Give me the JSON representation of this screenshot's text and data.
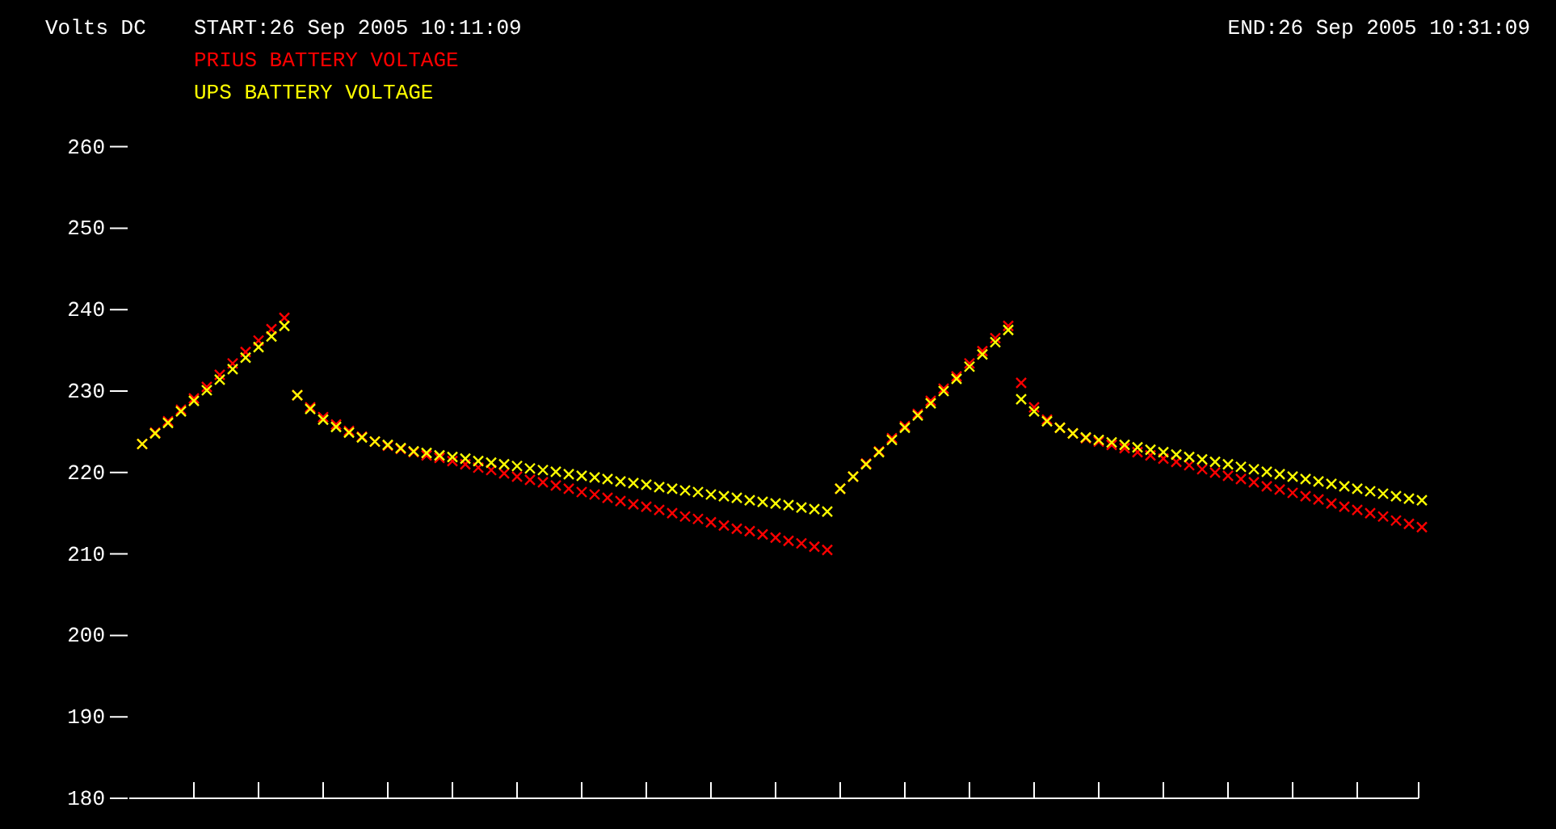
{
  "header": {
    "y_axis_label": "Volts DC",
    "start": "START:26 Sep 2005 10:11:09",
    "end": "END:26 Sep 2005 10:31:09"
  },
  "legend": [
    {
      "label": "PRIUS BATTERY VOLTAGE",
      "color": "#ff0000"
    },
    {
      "label": "UPS BATTERY VOLTAGE",
      "color": "#ffff00"
    }
  ],
  "y_tick_labels": [
    "260",
    "250",
    "240",
    "230",
    "220",
    "210",
    "200",
    "190",
    "180"
  ]
}
